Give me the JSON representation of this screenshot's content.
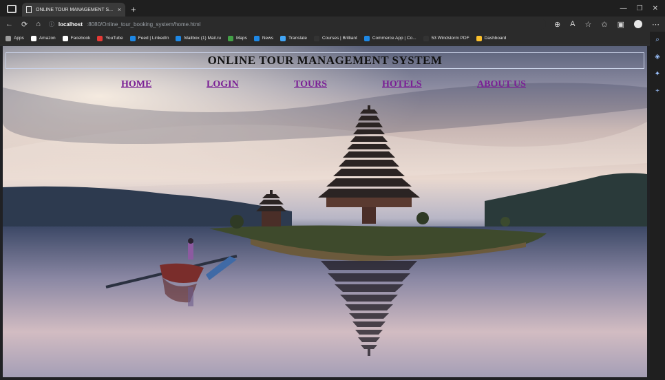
{
  "browser": {
    "tab_title": "ONLINE TOUR MANAGEMENT S...",
    "tab_close": "×",
    "new_tab": "+",
    "url_host": "localhost",
    "url_path": ":8080/Online_tour_booking_system/home.html",
    "bookmarks": [
      {
        "label": "Apps",
        "color": "#9e9e9e"
      },
      {
        "label": "Amazon",
        "color": "#ffffff"
      },
      {
        "label": "Facebook",
        "color": "#ffffff"
      },
      {
        "label": "YouTube",
        "color": "#e53935"
      },
      {
        "label": "Feed | LinkedIn",
        "color": "#1e88e5"
      },
      {
        "label": "Mailbox (1) Mail.ru",
        "color": "#1e88e5"
      },
      {
        "label": "Maps",
        "color": "#43a047"
      },
      {
        "label": "News",
        "color": "#1e88e5"
      },
      {
        "label": "Translate",
        "color": "#42a5f5"
      },
      {
        "label": "Courses | Brilliant",
        "color": "#333333"
      },
      {
        "label": "Commerce App | Co...",
        "color": "#1e88e5"
      },
      {
        "label": "53 Windstorm PDF",
        "color": "#333333"
      },
      {
        "label": "Dashboard",
        "color": "#fbc02d"
      }
    ]
  },
  "page": {
    "title": "ONLINE TOUR MANAGEMENT SYSTEM",
    "nav": {
      "home": "HOME",
      "login": "LOGIN",
      "tours": "TOURS",
      "hotels": "HOTELS",
      "about": "ABOUT US"
    }
  },
  "colors": {
    "link": "#7a1f95",
    "title": "#111111"
  }
}
